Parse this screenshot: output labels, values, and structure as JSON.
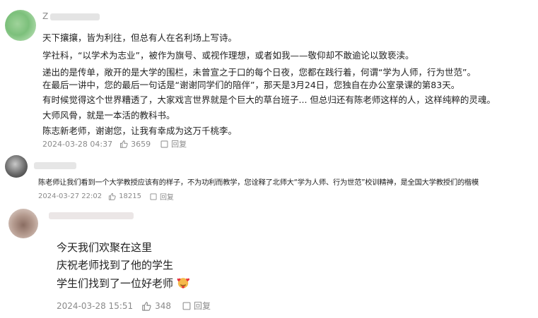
{
  "comments": [
    {
      "username": "Z",
      "lines": [
        "天下攘攘，皆为利往，但总有人在名利场上写诗。",
        "学社科，“以学术为志业”，被作为旗号、或视作理想，或者如我——敬仰却不敢逾论以致亵渎。",
        "递出的是传单，敞开的是大学的围栏，未曾宣之于口的每个日夜，您都在践行着，何谓“学为人师，行为世范”。",
        "在最后一讲中，您的最后一句话是“谢谢同学们的陪伴”，那天是3月24日，您独自在办公室录课的第83天。",
        "有时候觉得这个世界糟透了，大家戏言世界就是个巨大的草台班子... 但总归还有陈老师这样的人，这样纯粹的灵魂。",
        "大师风骨，就是一本活的教科书。",
        "陈志新老师，谢谢您，让我有幸成为这万千桃李。"
      ],
      "timestamp": "2024-03-28 04:37",
      "likes": "3659",
      "reply_label": "回复"
    },
    {
      "username": "",
      "lines": [
        "陈老师让我们看到一个大学教授应该有的样子，不为功利而教学，您诠释了北师大“学为人师、行为世范”校训精神，是全国大学教授们的楷模"
      ],
      "timestamp": "2024-03-27 22:02",
      "likes": "18215",
      "reply_label": "回复"
    },
    {
      "username": "",
      "lines": [
        "今天我们欢聚在这里",
        "庆祝老师找到了他的学生",
        "学生们找到了一位好老师"
      ],
      "timestamp": "2024-03-28 15:51",
      "likes": "348",
      "reply_label": "回复"
    }
  ],
  "icons": {
    "like": "thumbs-up-icon",
    "reply": "reply-icon",
    "emoji": "face-with-hearts-emoji"
  },
  "colors": {
    "text": "#222222",
    "meta": "#8a8a8a",
    "background": "#ffffff"
  }
}
